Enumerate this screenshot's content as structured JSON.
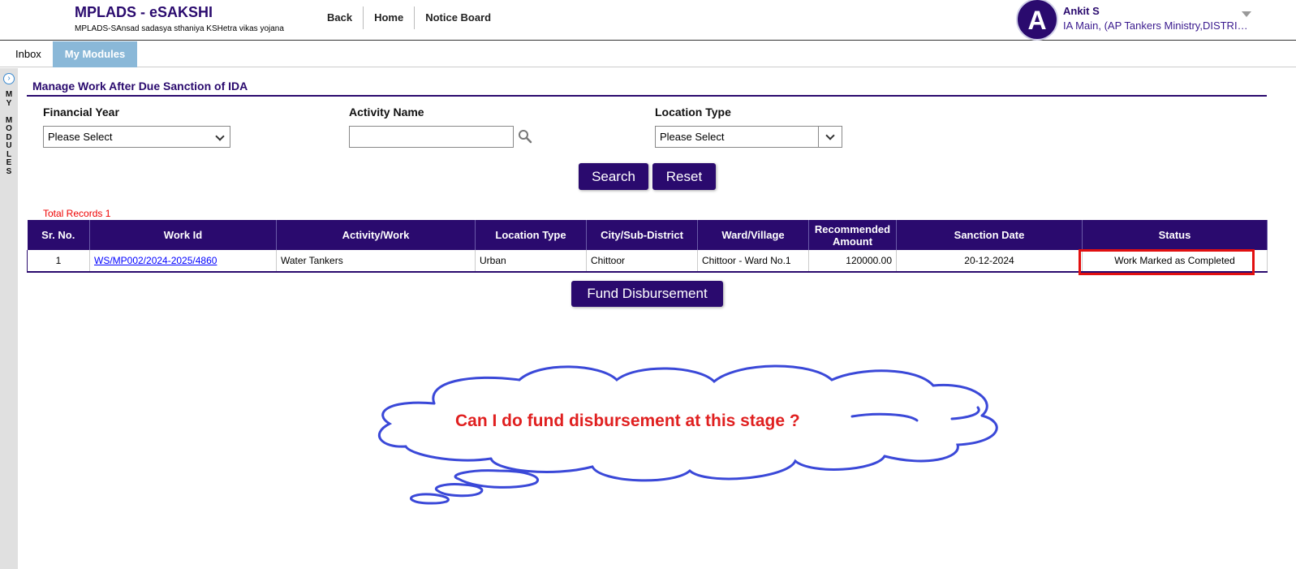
{
  "header": {
    "app_title": "MPLADS - eSAKSHI",
    "app_subtitle": "MPLADS-SAnsad sadasya sthaniya KSHetra vikas yojana",
    "nav": [
      "Back",
      "Home",
      "Notice Board"
    ],
    "user": {
      "initial": "A",
      "name": "Ankit S",
      "role": "IA Main, (AP Tankers Ministry,DISTRICT)"
    }
  },
  "tabs": {
    "inbox": "Inbox",
    "my_modules": "My Modules"
  },
  "sidebar": {
    "toggle_icon": "›",
    "label": "M\nY\n\nM\nO\nD\nU\nL\nE\nS"
  },
  "page": {
    "title": "Manage Work After Due Sanction of IDA",
    "filters": {
      "financial_year_label": "Financial Year",
      "financial_year_value": "Please Select",
      "activity_name_label": "Activity Name",
      "activity_name_value": "",
      "location_type_label": "Location Type",
      "location_type_value": "Please Select"
    },
    "search_label": "Search",
    "reset_label": "Reset",
    "total_records": "Total Records 1",
    "fund_label": "Fund Disbursement"
  },
  "table": {
    "headers": [
      "Sr. No.",
      "Work Id",
      "Activity/Work",
      "Location Type",
      "City/Sub-District",
      "Ward/Village",
      "Recommended Amount",
      "Sanction Date",
      "Status"
    ],
    "rows": [
      {
        "sr": "1",
        "work_id": "WS/MP002/2024-2025/4860",
        "activity": "Water Tankers",
        "location_type": "Urban",
        "city": "Chittoor",
        "ward": "Chittoor - Ward No.1",
        "amount": "120000.00",
        "sanction_date": "20-12-2024",
        "status": "Work Marked as Completed"
      }
    ]
  },
  "annotation": {
    "question": "Can I do fund disbursement at this stage ?",
    "highlight_color": "#e21010",
    "cloud_color": "#3a48d8"
  }
}
